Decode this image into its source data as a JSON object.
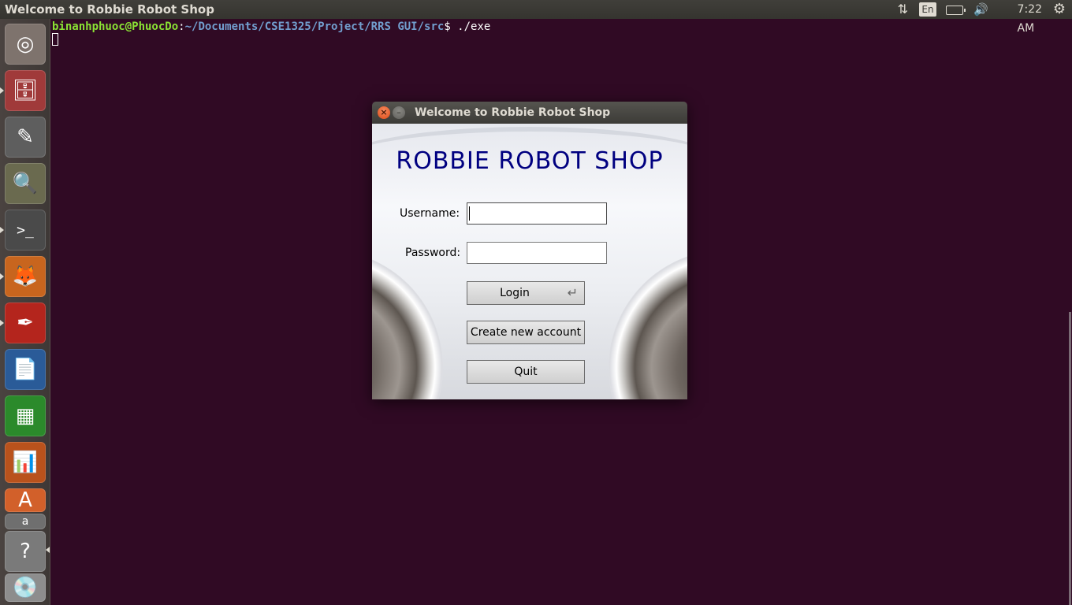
{
  "topbar": {
    "window_title": "Welcome to Robbie Robot Shop",
    "lang": "En",
    "clock": "7:22 AM"
  },
  "terminal": {
    "user": "binanhphuoc@PhuocDo",
    "sep": ":",
    "path": "~/Documents/CSE1325/Project/RRS GUI/src",
    "prompt_cmd": "$ ./exe"
  },
  "launcher": {
    "items": [
      {
        "name": "ubuntu-dash-icon",
        "color": "#8a7f78"
      },
      {
        "name": "files-icon",
        "color": "#9c3c3c"
      },
      {
        "name": "text-editor-icon",
        "color": "#6b6b6b"
      },
      {
        "name": "image-viewer-icon",
        "color": "#6e6e56"
      },
      {
        "name": "terminal-icon",
        "color": "#5a5a5a"
      },
      {
        "name": "firefox-icon",
        "color": "#d9722a"
      },
      {
        "name": "pdf-reader-icon",
        "color": "#b8281f"
      },
      {
        "name": "writer-icon",
        "color": "#2b5d9c"
      },
      {
        "name": "calc-icon",
        "color": "#2e8b2e"
      },
      {
        "name": "impress-icon",
        "color": "#c2551f"
      },
      {
        "name": "software-center-icon",
        "color": "#d9632a"
      },
      {
        "name": "help-icon",
        "color": "#7a7a7a"
      },
      {
        "name": "dvd-icon",
        "color": "#9a9a9a"
      }
    ]
  },
  "dialog": {
    "title": "Welcome to Robbie Robot Shop",
    "heading": "ROBBIE ROBOT SHOP",
    "username_label": "Username:",
    "password_label": "Password:",
    "username_value": "",
    "password_value": "",
    "login_label": "Login",
    "create_label": "Create new account",
    "quit_label": "Quit"
  }
}
